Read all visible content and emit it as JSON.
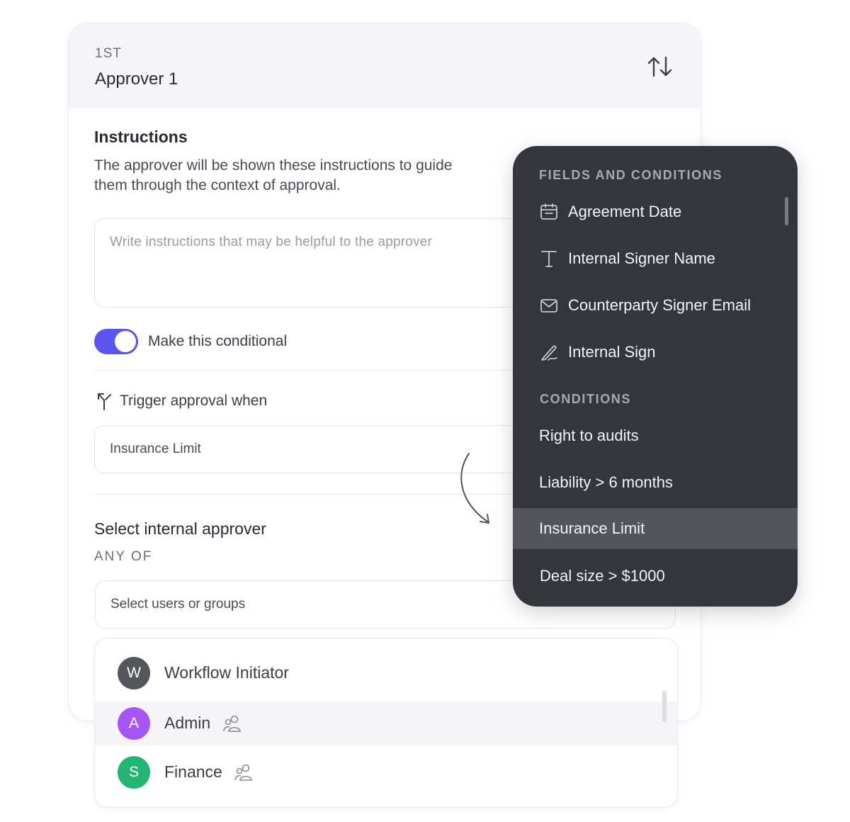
{
  "header": {
    "step_label": "1ST",
    "title": "Approver 1"
  },
  "instructions": {
    "heading": "Instructions",
    "description": "The approver will be shown these instructions to guide them through the context of approval.",
    "placeholder": "Write instructions that may be helpful to the approver"
  },
  "conditional": {
    "toggle_on": true,
    "label": "Make this conditional"
  },
  "trigger": {
    "label": "Trigger approval when",
    "selected_value": "Insurance Limit"
  },
  "approver": {
    "heading": "Select internal approver",
    "subheading": "ANY OF",
    "select_placeholder": "Select users or groups"
  },
  "users": [
    {
      "initial": "W",
      "name": "Workflow Initiator",
      "color": "#55555c",
      "group": false
    },
    {
      "initial": "A",
      "name": "Admin",
      "color": "#a855f7",
      "group": true
    },
    {
      "initial": "S",
      "name": "Finance",
      "color": "#22b573",
      "group": true
    }
  ],
  "dropdown": {
    "fields_heading": "FIELDS AND CONDITIONS",
    "fields": [
      {
        "icon": "calendar-icon",
        "label": "Agreement Date"
      },
      {
        "icon": "text-icon",
        "label": "Internal Signer Name"
      },
      {
        "icon": "envelope-icon",
        "label": "Counterparty Signer Email"
      },
      {
        "icon": "signature-icon",
        "label": "Internal Sign"
      }
    ],
    "conditions_heading": "CONDITIONS",
    "conditions": [
      {
        "label": "Right to audits",
        "active": false
      },
      {
        "label": "Liability > 6 months",
        "active": false
      },
      {
        "label": "Insurance Limit",
        "active": true
      },
      {
        "label": "Deal size > $1000",
        "active": false
      }
    ]
  },
  "colors": {
    "accent": "#5b54f0",
    "dropdown_bg": "#35353d",
    "dropdown_active": "#54545c"
  }
}
